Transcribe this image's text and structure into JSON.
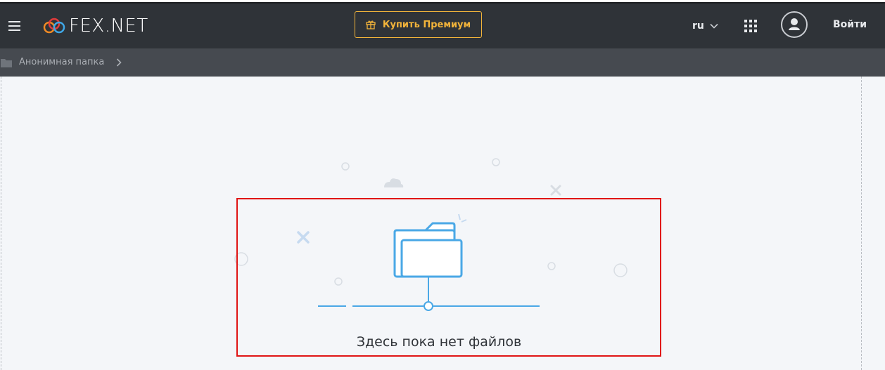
{
  "header": {
    "logo_text": "FEX.NET",
    "premium_label": "Купить Премиум",
    "language": "ru",
    "login_label": "Войти"
  },
  "breadcrumb": {
    "folder_label": "Анонимная папка"
  },
  "content": {
    "empty_message": "Здесь пока нет файлов"
  },
  "colors": {
    "header_bg": "#2f3338",
    "breadcrumb_bg": "#464a50",
    "premium_accent": "#f3b43a",
    "illustration_blue": "#4aa8e6",
    "highlight_red": "#e01515"
  },
  "icons": {
    "menu": "hamburger-icon",
    "gift": "gift-icon",
    "chevron": "chevron-down-icon",
    "apps": "grid-icon",
    "user": "user-avatar-icon",
    "folder": "folder-icon",
    "breadcrumb_arrow": "chevron-right-icon"
  }
}
